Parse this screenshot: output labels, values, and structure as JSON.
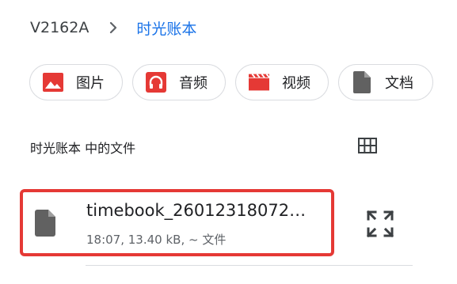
{
  "breadcrumb": {
    "device": "V2162A",
    "current": "时光账本"
  },
  "chips": [
    {
      "label": "图片",
      "icon": "image-icon",
      "color": "#e53935"
    },
    {
      "label": "音频",
      "icon": "headphones-icon",
      "color": "#e53935"
    },
    {
      "label": "视频",
      "icon": "movie-icon",
      "color": "#e53935"
    },
    {
      "label": "文档",
      "icon": "document-icon",
      "color": "#616161"
    }
  ],
  "section": {
    "title": "时光账本 中的文件",
    "view_toggle_icon": "grid-view-icon"
  },
  "files": [
    {
      "name": "timebook_26012318072…",
      "meta": "18:07, 13.40 kB, ~ 文件",
      "icon": "file-icon"
    }
  ],
  "colors": {
    "accent": "#1a73e8",
    "highlight": "#e53935",
    "chip_border": "#dadce0"
  }
}
